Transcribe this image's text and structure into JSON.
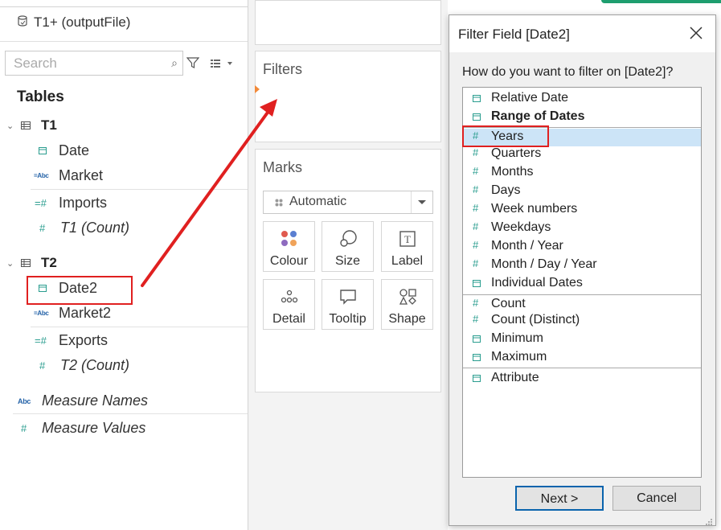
{
  "datasource": {
    "name": "T1+ (outputFile)"
  },
  "search": {
    "placeholder": "Search"
  },
  "data_pane": {
    "heading": "Tables",
    "tables": [
      {
        "name": "T1",
        "fields": [
          "Date",
          "Market",
          "Imports",
          "T1 (Count)"
        ]
      },
      {
        "name": "T2",
        "fields": [
          "Date2",
          "Market2",
          "Exports",
          "T2 (Count)"
        ]
      }
    ],
    "extra_fields": [
      "Measure Names",
      "Measure Values"
    ]
  },
  "shelves": {
    "filters_title": "Filters",
    "marks_title": "Marks",
    "mark_type": "Automatic",
    "mark_buttons": [
      "Colour",
      "Size",
      "Label",
      "Detail",
      "Tooltip",
      "Shape"
    ]
  },
  "dialog": {
    "title": "Filter Field [Date2]",
    "question": "How do you want to filter on [Date2]?",
    "options": [
      "Relative Date",
      "Range of Dates",
      "Years",
      "Quarters",
      "Months",
      "Days",
      "Week numbers",
      "Weekdays",
      "Month / Year",
      "Month / Day / Year",
      "Individual Dates",
      "Count",
      "Count (Distinct)",
      "Minimum",
      "Maximum",
      "Attribute"
    ],
    "selected_option": "Years",
    "next_label": "Next >",
    "cancel_label": "Cancel"
  },
  "colors": {
    "accent": "#1e9e6f",
    "highlight": "#e02020",
    "selection": "#cce4f7",
    "icon_teal": "#2a9d8f",
    "icon_blue": "#2563a8"
  }
}
